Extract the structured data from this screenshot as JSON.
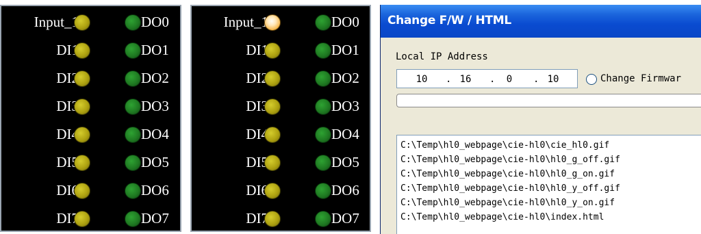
{
  "io_panels": [
    {
      "inputs": [
        {
          "label": "Input_1",
          "state": "off"
        },
        {
          "label": "DI1",
          "state": "off"
        },
        {
          "label": "DI2",
          "state": "off"
        },
        {
          "label": "DI3",
          "state": "off"
        },
        {
          "label": "DI4",
          "state": "off"
        },
        {
          "label": "DI5",
          "state": "off"
        },
        {
          "label": "DI6",
          "state": "off"
        },
        {
          "label": "DI7",
          "state": "off"
        }
      ],
      "outputs": [
        {
          "label": "DO0",
          "state": "off"
        },
        {
          "label": "DO1",
          "state": "off"
        },
        {
          "label": "DO2",
          "state": "off"
        },
        {
          "label": "DO3",
          "state": "off"
        },
        {
          "label": "DO4",
          "state": "off"
        },
        {
          "label": "DO5",
          "state": "off"
        },
        {
          "label": "DO6",
          "state": "off"
        },
        {
          "label": "DO7",
          "state": "off"
        }
      ]
    },
    {
      "inputs": [
        {
          "label": "Input_1",
          "state": "on"
        },
        {
          "label": "DI1",
          "state": "off"
        },
        {
          "label": "DI2",
          "state": "off"
        },
        {
          "label": "DI3",
          "state": "off"
        },
        {
          "label": "DI4",
          "state": "off"
        },
        {
          "label": "DI5",
          "state": "off"
        },
        {
          "label": "DI6",
          "state": "off"
        },
        {
          "label": "DI7",
          "state": "off"
        }
      ],
      "outputs": [
        {
          "label": "DO0",
          "state": "off"
        },
        {
          "label": "DO1",
          "state": "off"
        },
        {
          "label": "DO2",
          "state": "off"
        },
        {
          "label": "DO3",
          "state": "off"
        },
        {
          "label": "DO4",
          "state": "off"
        },
        {
          "label": "DO5",
          "state": "off"
        },
        {
          "label": "DO6",
          "state": "off"
        },
        {
          "label": "DO7",
          "state": "off"
        }
      ]
    }
  ],
  "colors": {
    "panel_background": "#000000",
    "input_led_off": "#aea211",
    "input_led_on": "#ffe7b8",
    "output_led_off": "#1f7a22",
    "titlebar": "#0a4bd0"
  },
  "icons": {
    "input_led": "circle-led-icon",
    "output_led": "circle-led-icon",
    "radio": "radio-button-icon"
  },
  "fw_window": {
    "title": "Change F/W / HTML",
    "ip_label": "Local IP Address",
    "ip": {
      "o1": "10",
      "o2": "16",
      "o3": "0",
      "o4": "10",
      "dot": "."
    },
    "radio_label": "Change Firmwar",
    "radio_selected": false,
    "progress": 0,
    "files": [
      "C:\\Temp\\hl0_webpage\\cie-hl0\\cie_hl0.gif",
      "C:\\Temp\\hl0_webpage\\cie-hl0\\hl0_g_off.gif",
      "C:\\Temp\\hl0_webpage\\cie-hl0\\hl0_g_on.gif",
      "C:\\Temp\\hl0_webpage\\cie-hl0\\hl0_y_off.gif",
      "C:\\Temp\\hl0_webpage\\cie-hl0\\hl0_y_on.gif",
      "C:\\Temp\\hl0_webpage\\cie-hl0\\index.html"
    ]
  }
}
